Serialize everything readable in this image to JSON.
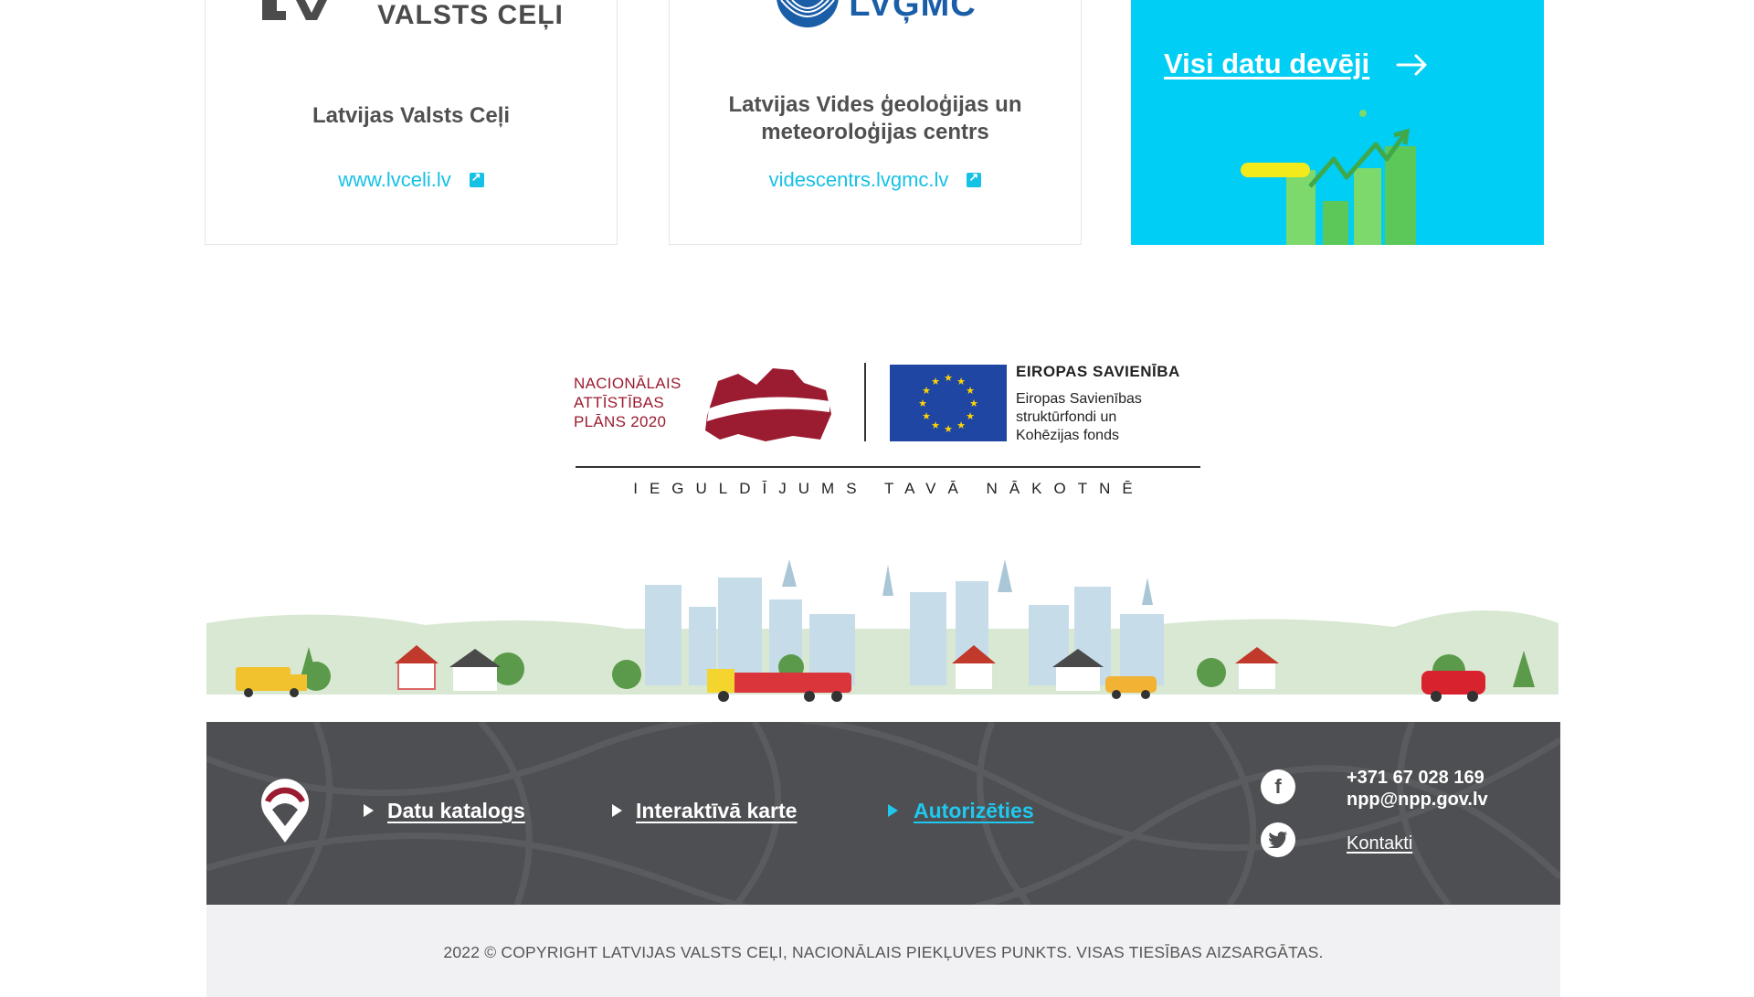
{
  "providers": [
    {
      "logo_text": "VALSTS CEĻI",
      "name": "Latvijas Valsts Ceļi",
      "link": "www.lvceli.lv"
    },
    {
      "logo_text": "LVĢMC",
      "name": "Latvijas Vides ģeoloģijas un meteoroloģijas centrs",
      "link": "videscentrs.lvgmc.lv"
    }
  ],
  "all_providers": {
    "label": "Visi datu devēji",
    "bg_color": "#00cef4"
  },
  "eu_banner": {
    "nap_lines": [
      "NACIONĀLAIS",
      "ATTĪSTĪBAS",
      "PLĀNS 2020"
    ],
    "eu_title": "EIROPAS SAVIENĪBA",
    "eu_sub_lines": [
      "Eiropas Savienības",
      "struktūrfondi un",
      "Kohēzijas fonds"
    ],
    "motto": "IEGULDĪJUMS TAVĀ NĀKOTNĒ"
  },
  "footer": {
    "bg_color": "#4e4f52",
    "nav": [
      {
        "label": "Datu katalogs"
      },
      {
        "label": "Interaktīvā karte"
      },
      {
        "label": "Autorizēties",
        "color": "#1fc8ef"
      }
    ],
    "social": [
      {
        "icon": "facebook-icon",
        "glyph": "f"
      },
      {
        "icon": "twitter-icon",
        "glyph": "t"
      }
    ],
    "phone": "+371 67 028 169",
    "email": "npp@npp.gov.lv",
    "contacts_label": "Kontakti"
  },
  "copyright": "2022 © COPYRIGHT LATVIJAS VALSTS CEĻI, NACIONĀLAIS PIEKĻUVES PUNKTS. VISAS TIESĪBAS AIZSARGĀTAS."
}
